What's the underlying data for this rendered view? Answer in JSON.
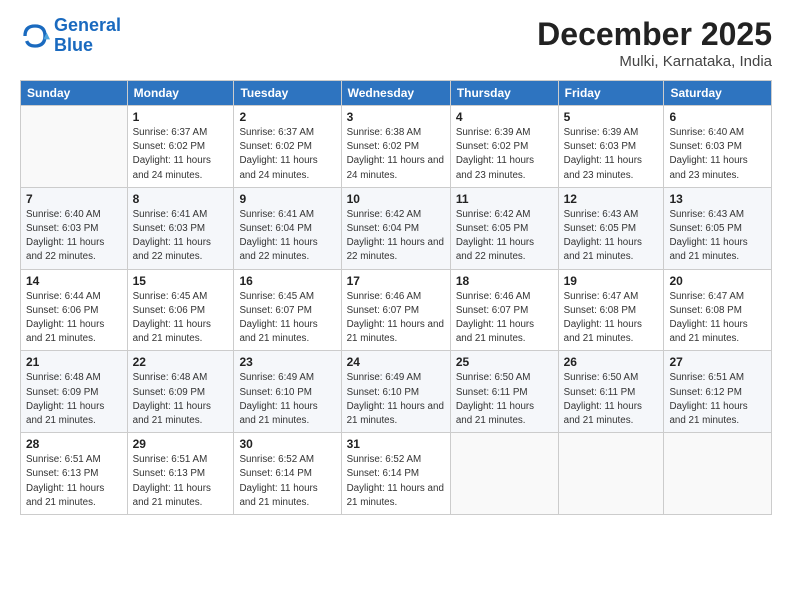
{
  "header": {
    "logo_line1": "General",
    "logo_line2": "Blue",
    "month_title": "December 2025",
    "location": "Mulki, Karnataka, India"
  },
  "weekdays": [
    "Sunday",
    "Monday",
    "Tuesday",
    "Wednesday",
    "Thursday",
    "Friday",
    "Saturday"
  ],
  "weeks": [
    [
      {
        "day": "",
        "sunrise": "",
        "sunset": "",
        "daylight": ""
      },
      {
        "day": "1",
        "sunrise": "6:37 AM",
        "sunset": "6:02 PM",
        "daylight": "11 hours and 24 minutes."
      },
      {
        "day": "2",
        "sunrise": "6:37 AM",
        "sunset": "6:02 PM",
        "daylight": "11 hours and 24 minutes."
      },
      {
        "day": "3",
        "sunrise": "6:38 AM",
        "sunset": "6:02 PM",
        "daylight": "11 hours and 24 minutes."
      },
      {
        "day": "4",
        "sunrise": "6:39 AM",
        "sunset": "6:02 PM",
        "daylight": "11 hours and 23 minutes."
      },
      {
        "day": "5",
        "sunrise": "6:39 AM",
        "sunset": "6:03 PM",
        "daylight": "11 hours and 23 minutes."
      },
      {
        "day": "6",
        "sunrise": "6:40 AM",
        "sunset": "6:03 PM",
        "daylight": "11 hours and 23 minutes."
      }
    ],
    [
      {
        "day": "7",
        "sunrise": "6:40 AM",
        "sunset": "6:03 PM",
        "daylight": "11 hours and 22 minutes."
      },
      {
        "day": "8",
        "sunrise": "6:41 AM",
        "sunset": "6:03 PM",
        "daylight": "11 hours and 22 minutes."
      },
      {
        "day": "9",
        "sunrise": "6:41 AM",
        "sunset": "6:04 PM",
        "daylight": "11 hours and 22 minutes."
      },
      {
        "day": "10",
        "sunrise": "6:42 AM",
        "sunset": "6:04 PM",
        "daylight": "11 hours and 22 minutes."
      },
      {
        "day": "11",
        "sunrise": "6:42 AM",
        "sunset": "6:05 PM",
        "daylight": "11 hours and 22 minutes."
      },
      {
        "day": "12",
        "sunrise": "6:43 AM",
        "sunset": "6:05 PM",
        "daylight": "11 hours and 21 minutes."
      },
      {
        "day": "13",
        "sunrise": "6:43 AM",
        "sunset": "6:05 PM",
        "daylight": "11 hours and 21 minutes."
      }
    ],
    [
      {
        "day": "14",
        "sunrise": "6:44 AM",
        "sunset": "6:06 PM",
        "daylight": "11 hours and 21 minutes."
      },
      {
        "day": "15",
        "sunrise": "6:45 AM",
        "sunset": "6:06 PM",
        "daylight": "11 hours and 21 minutes."
      },
      {
        "day": "16",
        "sunrise": "6:45 AM",
        "sunset": "6:07 PM",
        "daylight": "11 hours and 21 minutes."
      },
      {
        "day": "17",
        "sunrise": "6:46 AM",
        "sunset": "6:07 PM",
        "daylight": "11 hours and 21 minutes."
      },
      {
        "day": "18",
        "sunrise": "6:46 AM",
        "sunset": "6:07 PM",
        "daylight": "11 hours and 21 minutes."
      },
      {
        "day": "19",
        "sunrise": "6:47 AM",
        "sunset": "6:08 PM",
        "daylight": "11 hours and 21 minutes."
      },
      {
        "day": "20",
        "sunrise": "6:47 AM",
        "sunset": "6:08 PM",
        "daylight": "11 hours and 21 minutes."
      }
    ],
    [
      {
        "day": "21",
        "sunrise": "6:48 AM",
        "sunset": "6:09 PM",
        "daylight": "11 hours and 21 minutes."
      },
      {
        "day": "22",
        "sunrise": "6:48 AM",
        "sunset": "6:09 PM",
        "daylight": "11 hours and 21 minutes."
      },
      {
        "day": "23",
        "sunrise": "6:49 AM",
        "sunset": "6:10 PM",
        "daylight": "11 hours and 21 minutes."
      },
      {
        "day": "24",
        "sunrise": "6:49 AM",
        "sunset": "6:10 PM",
        "daylight": "11 hours and 21 minutes."
      },
      {
        "day": "25",
        "sunrise": "6:50 AM",
        "sunset": "6:11 PM",
        "daylight": "11 hours and 21 minutes."
      },
      {
        "day": "26",
        "sunrise": "6:50 AM",
        "sunset": "6:11 PM",
        "daylight": "11 hours and 21 minutes."
      },
      {
        "day": "27",
        "sunrise": "6:51 AM",
        "sunset": "6:12 PM",
        "daylight": "11 hours and 21 minutes."
      }
    ],
    [
      {
        "day": "28",
        "sunrise": "6:51 AM",
        "sunset": "6:13 PM",
        "daylight": "11 hours and 21 minutes."
      },
      {
        "day": "29",
        "sunrise": "6:51 AM",
        "sunset": "6:13 PM",
        "daylight": "11 hours and 21 minutes."
      },
      {
        "day": "30",
        "sunrise": "6:52 AM",
        "sunset": "6:14 PM",
        "daylight": "11 hours and 21 minutes."
      },
      {
        "day": "31",
        "sunrise": "6:52 AM",
        "sunset": "6:14 PM",
        "daylight": "11 hours and 21 minutes."
      },
      {
        "day": "",
        "sunrise": "",
        "sunset": "",
        "daylight": ""
      },
      {
        "day": "",
        "sunrise": "",
        "sunset": "",
        "daylight": ""
      },
      {
        "day": "",
        "sunrise": "",
        "sunset": "",
        "daylight": ""
      }
    ]
  ]
}
